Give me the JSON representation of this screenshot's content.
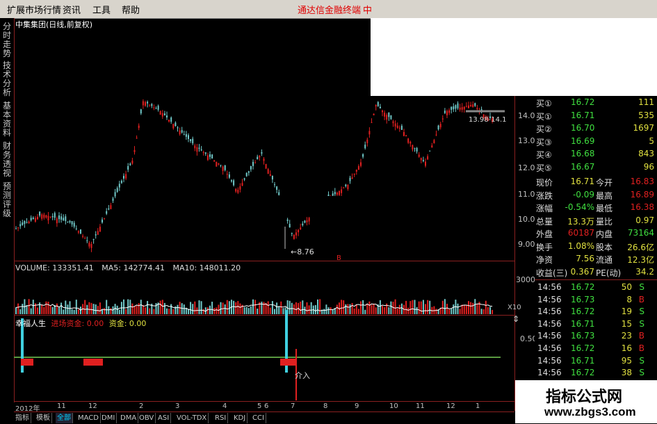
{
  "menu": {
    "items": [
      "扩展市场行情",
      "资讯",
      "工具",
      "帮助"
    ],
    "promo": "通达信金融终端",
    "promo_tail": "中"
  },
  "side_tabs": [
    "分时走势",
    "技术分析",
    "基本资料",
    "财务透视",
    "预测评级"
  ],
  "chart": {
    "title": "中集集团(日线,前复权)",
    "y_labels": [
      "14.00",
      "13.00",
      "12.00",
      "11.00",
      "10.00",
      "9.00"
    ],
    "low_annotation": "8.76",
    "range_annotation": "13.98-14.1",
    "marker_b": "B"
  },
  "volume": {
    "label": "VOLUME: 133351.41",
    "ma5": "MA5: 142774.41",
    "ma10": "MA10: 148011.20",
    "y_label": "30000",
    "unit": "X10"
  },
  "indicator": {
    "name": "幸福人生",
    "fund_in_label": "进场资金: 0.00",
    "fund_label": "资金: 0.00",
    "y_label": "0.50",
    "entry_label": "介入"
  },
  "quote": {
    "bids": [
      {
        "label": "买①",
        "price": "16.72",
        "vol": "111"
      },
      {
        "label": "买①",
        "price": "16.71",
        "vol": "535"
      },
      {
        "label": "买②",
        "price": "16.70",
        "vol": "1697"
      },
      {
        "label": "买③",
        "price": "16.69",
        "vol": "5"
      },
      {
        "label": "买④",
        "price": "16.68",
        "vol": "843"
      },
      {
        "label": "买⑤",
        "price": "16.67",
        "vol": "96"
      }
    ],
    "stats": [
      {
        "k1": "现价",
        "v1": "16.71",
        "k2": "今开",
        "v2": "16.83"
      },
      {
        "k1": "涨跌",
        "v1": "-0.09",
        "k2": "最高",
        "v2": "16.89"
      },
      {
        "k1": "涨幅",
        "v1": "-0.54%",
        "k2": "最低",
        "v2": "16.38"
      },
      {
        "k1": "总量",
        "v1": "13.3万",
        "k2": "量比",
        "v2": "0.97"
      },
      {
        "k1": "外盘",
        "v1": "60187",
        "k2": "内盘",
        "v2": "73164"
      },
      {
        "k1": "换手",
        "v1": "1.08%",
        "k2": "股本",
        "v2": "26.6亿"
      },
      {
        "k1": "净资",
        "v1": "7.56",
        "k2": "流通",
        "v2": "12.3亿"
      },
      {
        "k1": "收益(三)",
        "v1": "0.367",
        "k2": "PE(动)",
        "v2": "34.2"
      }
    ],
    "ticks": [
      {
        "time": "14:56",
        "price": "16.72",
        "vol": "50",
        "side": "S"
      },
      {
        "time": "14:56",
        "price": "16.73",
        "vol": "8",
        "side": "B"
      },
      {
        "time": "14:56",
        "price": "16.72",
        "vol": "19",
        "side": "S"
      },
      {
        "time": "14:56",
        "price": "16.71",
        "vol": "15",
        "side": "S"
      },
      {
        "time": "14:56",
        "price": "16.73",
        "vol": "23",
        "side": "B"
      },
      {
        "time": "14:56",
        "price": "16.72",
        "vol": "16",
        "side": "B"
      },
      {
        "time": "14:56",
        "price": "16.71",
        "vol": "95",
        "side": "S"
      },
      {
        "time": "14:56",
        "price": "16.72",
        "vol": "38",
        "side": "S"
      }
    ]
  },
  "date_axis": [
    "2012年",
    "11",
    "12",
    "2",
    "3",
    "4",
    "5",
    "6",
    "7",
    "8",
    "9",
    "10",
    "11",
    "12",
    "1"
  ],
  "bottom_tabs": [
    "指标",
    "模板",
    "全部",
    "MACD",
    "DMI",
    "DMA",
    "OBV",
    "ASI",
    "VOL-TDX",
    "RSI",
    "KDJ",
    "CCI"
  ],
  "watermark": {
    "title": "指标公式网",
    "url": "www.zbgs3.com"
  },
  "colors": {
    "up": "#e02020",
    "down": "#70c8c8",
    "panel_border": "#8a2020",
    "accent_cyan": "#40d0e0"
  }
}
